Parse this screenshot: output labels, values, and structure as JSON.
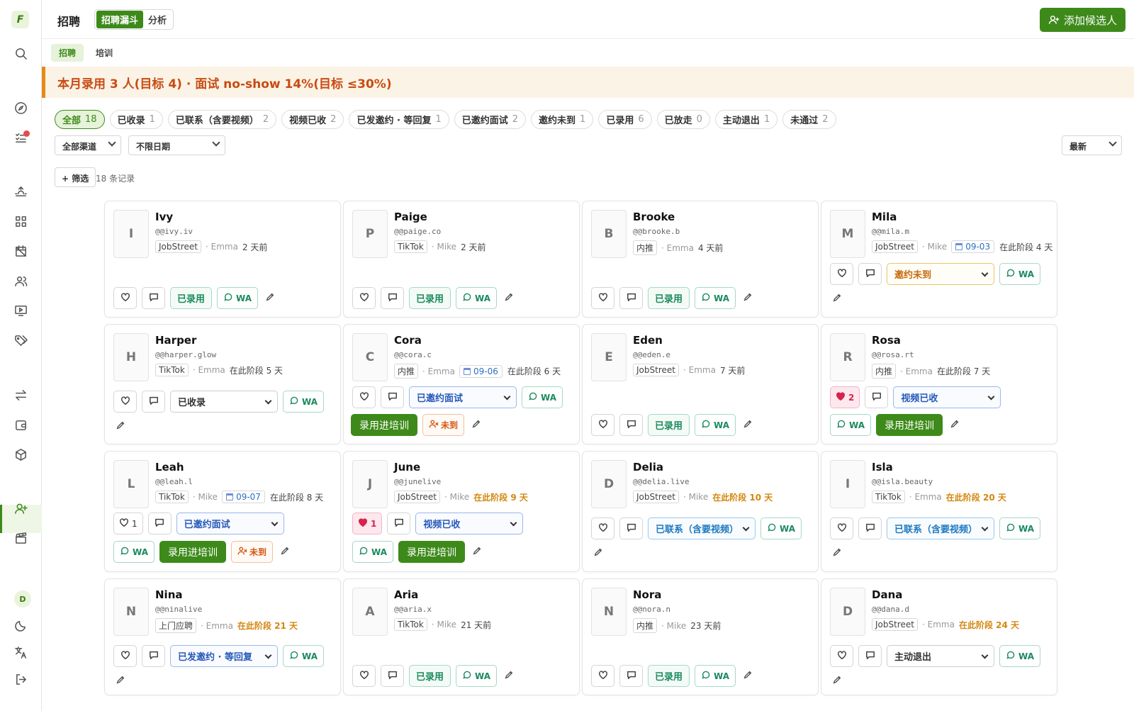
{
  "app": {
    "logo": "F",
    "title": "招聘",
    "view_tabs": [
      "招聘漏斗",
      "分析"
    ],
    "add_button": "添加候选人",
    "user_initial": "D",
    "accent": "#3d8a1a"
  },
  "subtabs": [
    "招聘",
    "培训"
  ],
  "banner": "本月录用 3 人(目标 4) · 面试 no-show 14%(目标 ≤30%)",
  "chips": [
    {
      "label": "全部",
      "count": "18"
    },
    {
      "label": "已收录",
      "count": "1"
    },
    {
      "label": "已联系（含要视频）",
      "count": "2"
    },
    {
      "label": "视频已收",
      "count": "2"
    },
    {
      "label": "已发邀约 · 等回复",
      "count": "1"
    },
    {
      "label": "已邀约面试",
      "count": "2"
    },
    {
      "label": "邀约未到",
      "count": "1"
    },
    {
      "label": "已录用",
      "count": "6"
    },
    {
      "label": "已放走",
      "count": "0"
    },
    {
      "label": "主动退出",
      "count": "1"
    },
    {
      "label": "未通过",
      "count": "2"
    }
  ],
  "filters": {
    "channel": "全部渠道",
    "date": "不限日期",
    "sort": "最新",
    "add_filter": "+ 筛选",
    "record_count": "18 条记录"
  },
  "labels": {
    "hired": "已录用",
    "wa": "WA",
    "train": "录用进培训",
    "noshow": "未到"
  },
  "cards": [
    {
      "initial": "I",
      "name": "Ivy",
      "handle": "@@ivy.iv",
      "source": "JobStreet",
      "recruiter": "Emma",
      "time": "2 天前"
    },
    {
      "initial": "P",
      "name": "Paige",
      "handle": "@@paige.co",
      "source": "TikTok",
      "recruiter": "Mike",
      "time": "2 天前"
    },
    {
      "initial": "B",
      "name": "Brooke",
      "handle": "@@brooke.b",
      "source": "内推",
      "recruiter": "Emma",
      "time": "4 天前"
    },
    {
      "initial": "M",
      "name": "Mila",
      "handle": "@@mila.m",
      "source": "JobStreet",
      "recruiter": "Mike",
      "date": "09-03",
      "time": "在此阶段 4 天",
      "status": "邀约未到"
    },
    {
      "initial": "H",
      "name": "Harper",
      "handle": "@@harper.glow",
      "source": "TikTok",
      "recruiter": "Emma",
      "time": "在此阶段 5 天",
      "status": "已收录"
    },
    {
      "initial": "C",
      "name": "Cora",
      "handle": "@@cora.c",
      "source": "内推",
      "recruiter": "Emma",
      "date": "09-06",
      "time": "在此阶段 6 天",
      "status": "已邀约面试"
    },
    {
      "initial": "E",
      "name": "Eden",
      "handle": "@@eden.e",
      "source": "JobStreet",
      "recruiter": "Emma",
      "time": "7 天前"
    },
    {
      "initial": "R",
      "name": "Rosa",
      "handle": "@@rosa.rt",
      "source": "内推",
      "recruiter": "Emma",
      "time": "在此阶段 7 天",
      "likes": "2",
      "status": "视频已收"
    },
    {
      "initial": "L",
      "name": "Leah",
      "handle": "@@leah.l",
      "source": "TikTok",
      "recruiter": "Mike",
      "date": "09-07",
      "time": "在此阶段 8 天",
      "likes": "1",
      "status": "已邀约面试"
    },
    {
      "initial": "J",
      "name": "June",
      "handle": "@@junelive",
      "source": "JobStreet",
      "recruiter": "Mike",
      "time": "在此阶段 9 天",
      "likes": "1",
      "status": "视频已收"
    },
    {
      "initial": "D",
      "name": "Delia",
      "handle": "@@delia.live",
      "source": "JobStreet",
      "recruiter": "Mike",
      "time": "在此阶段 10 天",
      "status": "已联系（含要视频）"
    },
    {
      "initial": "I",
      "name": "Isla",
      "handle": "@@isla.beauty",
      "source": "TikTok",
      "recruiter": "Emma",
      "time": "在此阶段 20 天",
      "status": "已联系（含要视频）"
    },
    {
      "initial": "N",
      "name": "Nina",
      "handle": "@@ninalive",
      "source": "上门应聘",
      "recruiter": "Emma",
      "time": "在此阶段 21 天",
      "status": "已发邀约 · 等回复"
    },
    {
      "initial": "A",
      "name": "Aria",
      "handle": "@@aria.x",
      "source": "TikTok",
      "recruiter": "Mike",
      "time": "21 天前"
    },
    {
      "initial": "N",
      "name": "Nora",
      "handle": "@@nora.n",
      "source": "内推",
      "recruiter": "Mike",
      "time": "23 天前"
    },
    {
      "initial": "D",
      "name": "Dana",
      "handle": "@@dana.d",
      "source": "JobStreet",
      "recruiter": "Emma",
      "time": "在此阶段 24 天",
      "status": "主动退出"
    }
  ]
}
